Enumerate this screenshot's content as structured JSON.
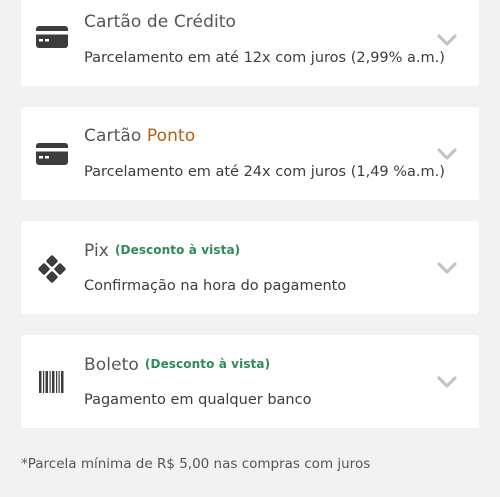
{
  "payment_options": [
    {
      "title_main": "Cartão de Crédito",
      "title_accent": "",
      "tag": "",
      "description": "Parcelamento em até 12x com juros (2,99% a.m.)",
      "icon": "credit-card-icon"
    },
    {
      "title_main": "Cartão ",
      "title_accent": "Ponto",
      "tag": "",
      "description": "Parcelamento em até 24x com juros (1,49 %a.m.)",
      "icon": "credit-card-icon"
    },
    {
      "title_main": "Pix",
      "title_accent": "",
      "tag": "(Desconto à vista)",
      "description": "Confirmação na hora do pagamento",
      "icon": "pix-icon"
    },
    {
      "title_main": "Boleto",
      "title_accent": "",
      "tag": "(Desconto à vista)",
      "description": "Pagamento em qualquer banco",
      "icon": "barcode-icon"
    }
  ],
  "footnote": "*Parcela mínima de R$ 5,00 nas compras com juros",
  "colors": {
    "accent": "#b85c12",
    "discount_tag": "#2e8b57",
    "background": "#f2f2f2",
    "card": "#ffffff"
  }
}
